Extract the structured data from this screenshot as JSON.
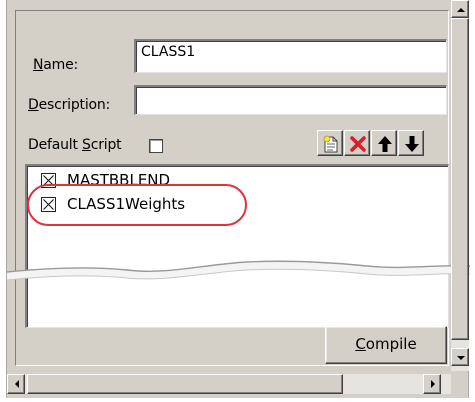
{
  "form": {
    "name_label_prefix": "",
    "name_label_accel": "N",
    "name_label_rest": "ame:",
    "name_value": "CLASS1",
    "description_label_accel": "D",
    "description_label_rest": "escription:",
    "description_value": "",
    "default_script_label_before": "Default ",
    "default_script_label_accel": "S",
    "default_script_label_after": "cript",
    "default_script_checked": false
  },
  "toolbar": {
    "new_icon": "new-script-icon",
    "delete_icon": "delete-icon",
    "up_icon": "arrow-up-icon",
    "down_icon": "arrow-down-icon"
  },
  "scripts": [
    {
      "label": "MASTBBLEND",
      "checked": true
    },
    {
      "label": "CLASS1Weights",
      "checked": true
    }
  ],
  "compile_button": {
    "accel": "C",
    "rest": "ompile"
  },
  "colors": {
    "dialog_bg": "#d4d0c8",
    "highlight_ring": "#e0323a",
    "delete_red": "#d8202a"
  }
}
